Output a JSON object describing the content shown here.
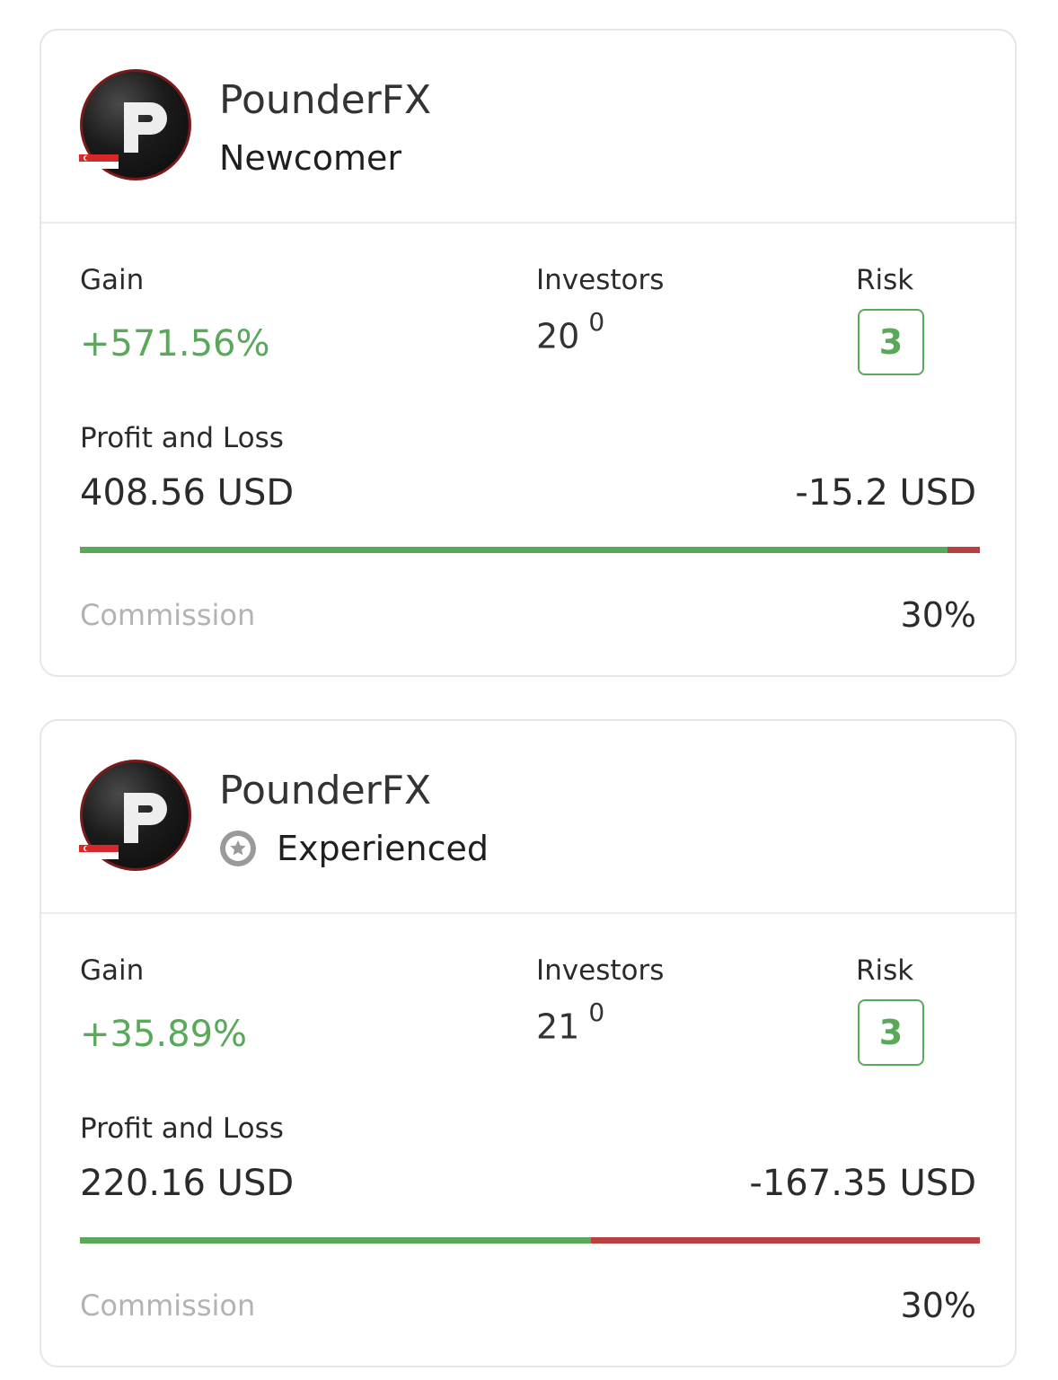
{
  "cards": [
    {
      "name": "PounderFX",
      "level": "Newcomer",
      "level_icon": "",
      "labels": {
        "gain": "Gain",
        "investors": "Investors",
        "risk": "Risk",
        "pnl": "Profit and Loss",
        "commission": "Commission"
      },
      "gain": "+571.56%",
      "investors": "20",
      "investors_delta": "0",
      "risk": "3",
      "profit": "408.56 USD",
      "loss": "-15.2 USD",
      "profit_share": 0.964,
      "commission": "30%"
    },
    {
      "name": "PounderFX",
      "level": "Experienced",
      "level_icon": "star-badge-icon",
      "labels": {
        "gain": "Gain",
        "investors": "Investors",
        "risk": "Risk",
        "pnl": "Profit and Loss",
        "commission": "Commission"
      },
      "gain": "+35.89%",
      "investors": "21",
      "investors_delta": "0",
      "risk": "3",
      "profit": "220.16 USD",
      "loss": "-167.35 USD",
      "profit_share": 0.568,
      "commission": "30%"
    }
  ],
  "colors": {
    "positive": "#5aa85a",
    "negative": "#b94040",
    "muted": "#b3b3b3",
    "flag": "#d62828"
  }
}
